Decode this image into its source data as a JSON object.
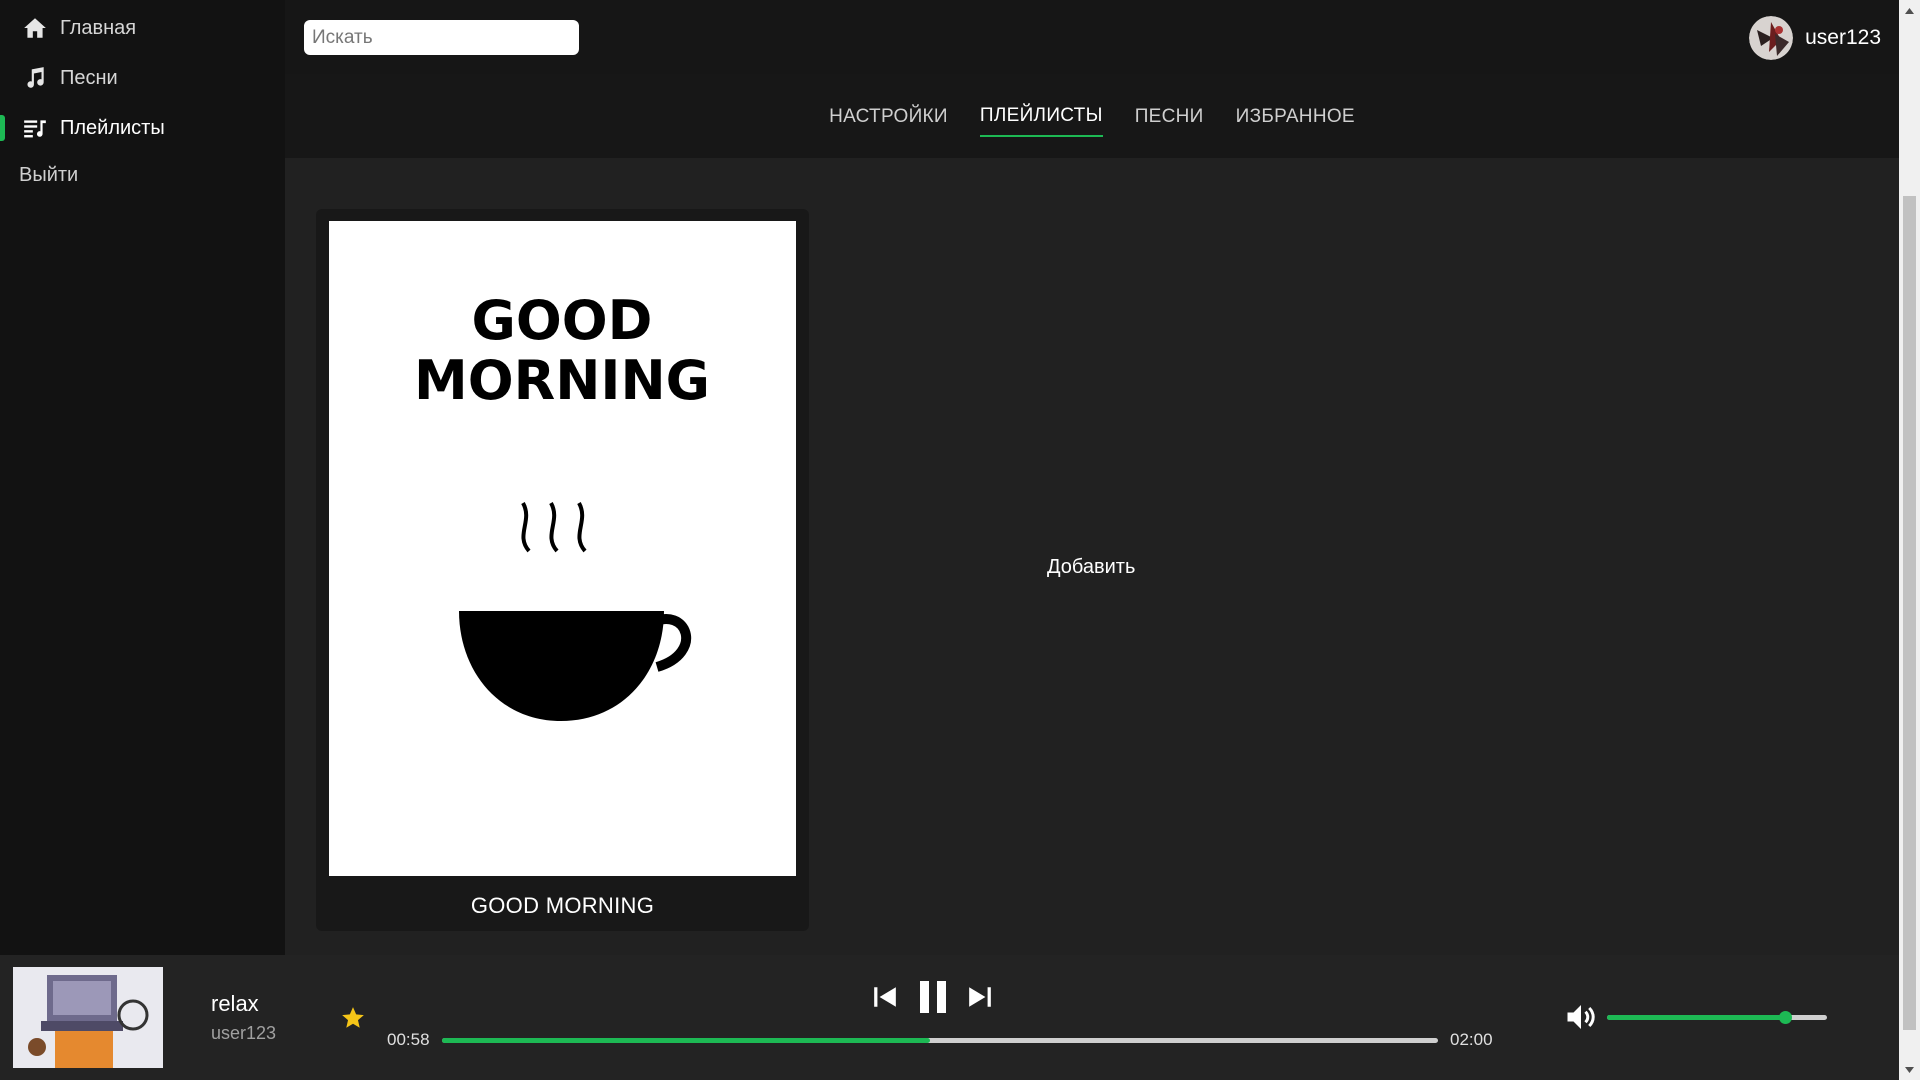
{
  "sidebar": {
    "items": [
      {
        "label": "Главная",
        "icon": "home-icon"
      },
      {
        "label": "Песни",
        "icon": "music-note-icon"
      },
      {
        "label": "Плейлисты",
        "icon": "playlist-icon",
        "active": true
      }
    ],
    "logout_label": "Выйти"
  },
  "topbar": {
    "search_placeholder": "Искать",
    "username": "user123"
  },
  "tabs": [
    {
      "label": "НАСТРОЙКИ"
    },
    {
      "label": "ПЛЕЙЛИСТЫ",
      "active": true
    },
    {
      "label": "ПЕСНИ"
    },
    {
      "label": "ИЗБРАННОЕ"
    }
  ],
  "playlists": [
    {
      "title": "GOOD MORNING",
      "cover_text": [
        "GOOD",
        "MORNING"
      ]
    }
  ],
  "add_label": "Добавить",
  "player": {
    "title": "relax",
    "artist": "user123",
    "current_time": "00:58",
    "total_time": "02:00",
    "progress_fraction": 0.49,
    "volume_fraction": 0.81,
    "favorite": true
  },
  "colors": {
    "accent": "#1db954",
    "star": "#f5c518",
    "background": "#121212",
    "content_bg": "#212121"
  }
}
